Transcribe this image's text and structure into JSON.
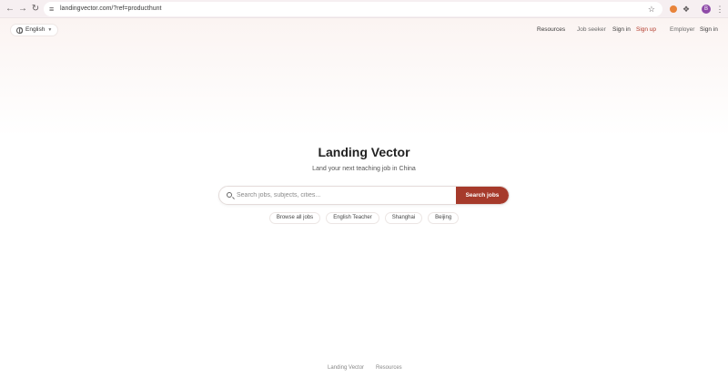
{
  "browser": {
    "url": "landingvector.com/?ref=producthunt",
    "avatar_letter": "B"
  },
  "header": {
    "language": "English",
    "nav": {
      "resources": "Resources",
      "job_seeker": "Job seeker",
      "seeker_sign_in": "Sign in",
      "sign_up": "Sign up",
      "employer": "Employer",
      "employer_sign_in": "Sign in"
    }
  },
  "hero": {
    "title": "Landing Vector",
    "subtitle": "Land your next teaching job in China"
  },
  "search": {
    "placeholder": "Search jobs, subjects, cities...",
    "button_label": "Search jobs"
  },
  "chips": [
    "Browse all jobs",
    "English Teacher",
    "Shanghai",
    "Beijing"
  ],
  "footer": {
    "brand": "Landing Vector",
    "resources": "Resources"
  },
  "colors": {
    "accent": "#a63a2b",
    "signup": "#b23a2a"
  }
}
